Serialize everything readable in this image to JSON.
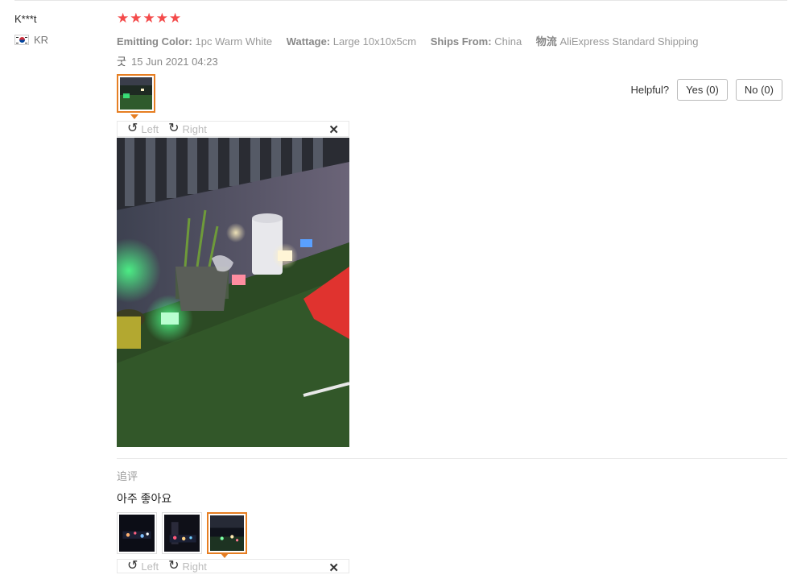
{
  "reviewer": {
    "name": "K***t",
    "country_code": "KR",
    "flag": "south-korea-flag"
  },
  "rating": {
    "stars": 5,
    "max": 5,
    "color": "#f44b4b"
  },
  "attributes": [
    {
      "key": "Emitting Color:",
      "value": "1pc Warm White"
    },
    {
      "key": "Wattage:",
      "value": "Large 10x10x5cm"
    },
    {
      "key": "Ships From:",
      "value": "China"
    },
    {
      "key": "物流",
      "value": "AliExpress Standard Shipping"
    }
  ],
  "review": {
    "text": "굿",
    "date": "15 Jun 2021 04:23"
  },
  "helpful": {
    "label": "Helpful?",
    "yes_label": "Yes (0)",
    "no_label": "No (0)"
  },
  "viewer": {
    "left_label": "Left",
    "right_label": "Right",
    "close_icon": "close-icon",
    "accent": "#e67e22"
  },
  "additional_review": {
    "label": "追评",
    "text": "아주 좋아요"
  }
}
